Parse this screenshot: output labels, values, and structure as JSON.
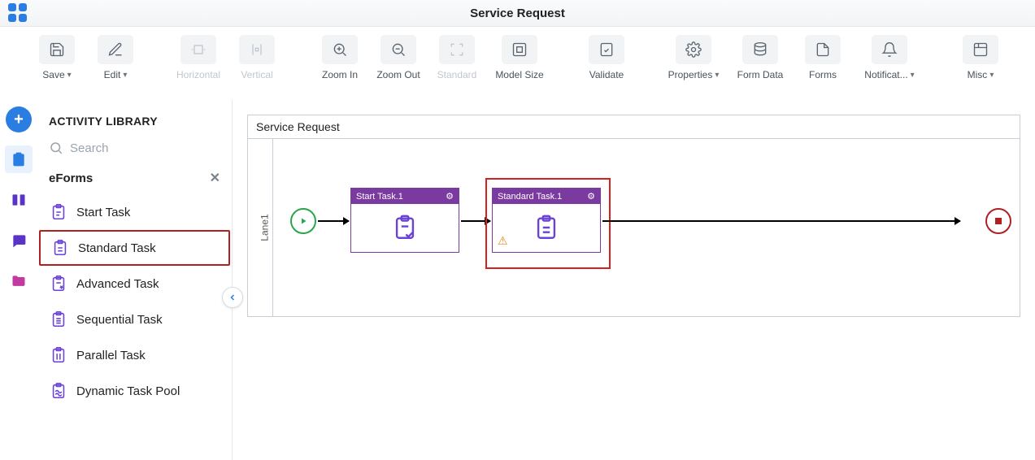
{
  "header": {
    "title": "Service Request"
  },
  "toolbar": {
    "save": "Save",
    "edit": "Edit",
    "horizontal": "Horizontal",
    "vertical": "Vertical",
    "zoom_in": "Zoom In",
    "zoom_out": "Zoom Out",
    "standard": "Standard",
    "model_size": "Model Size",
    "validate": "Validate",
    "properties": "Properties",
    "form_data": "Form Data",
    "forms": "Forms",
    "notifications": "Notificat...",
    "misc": "Misc"
  },
  "panel": {
    "heading": "ACTIVITY LIBRARY",
    "search_placeholder": "Search",
    "section": "eForms",
    "items": [
      {
        "label": "Start Task",
        "selected": false
      },
      {
        "label": "Standard Task",
        "selected": true
      },
      {
        "label": "Advanced Task",
        "selected": false
      },
      {
        "label": "Sequential Task",
        "selected": false
      },
      {
        "label": "Parallel Task",
        "selected": false
      },
      {
        "label": "Dynamic Task Pool",
        "selected": false
      }
    ]
  },
  "canvas": {
    "title": "Service Request",
    "lane": "Lane1",
    "tasks": {
      "start": {
        "title": "Start Task.1"
      },
      "standard": {
        "title": "Standard Task.1",
        "warning": true
      }
    }
  }
}
